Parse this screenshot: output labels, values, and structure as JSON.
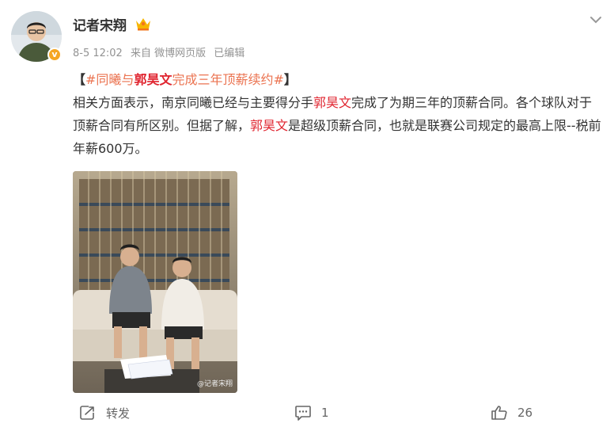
{
  "author": {
    "name": "记者宋翔",
    "time": "8-5 12:02",
    "source": "来自 微博网页版",
    "edited": "已编辑"
  },
  "post": {
    "topic_open": "【",
    "topic_tag_pre": "#同曦与",
    "topic_name": "郭昊文",
    "topic_tag_post": "完成三年顶薪续约#",
    "topic_close": "】",
    "p1_a": "相关方面表示，南京同曦已经与主要得分手",
    "p1_name": "郭昊文",
    "p1_b": "完成了为期三年的顶薪合同。各个球队对于顶薪合同有所区别。但据了解，",
    "p1_name2": "郭昊文",
    "p1_c": "是超级顶薪合同，也就是联赛公司规定的最高上限--税前年薪600万。"
  },
  "image": {
    "watermark": "@记者宋翔"
  },
  "actions": {
    "repost_label": "转发",
    "comment_count": "1",
    "like_count": "26"
  },
  "icons": {
    "verified": "verified-badge-icon",
    "crown": "crown-icon",
    "menu": "chevron-down-icon",
    "repost": "repost-icon",
    "comment": "comment-icon",
    "like": "thumbs-up-icon"
  },
  "colors": {
    "topic": "#eb7350",
    "name_highlight": "#e0242f",
    "meta": "#939393",
    "verified": "#f5a623"
  }
}
